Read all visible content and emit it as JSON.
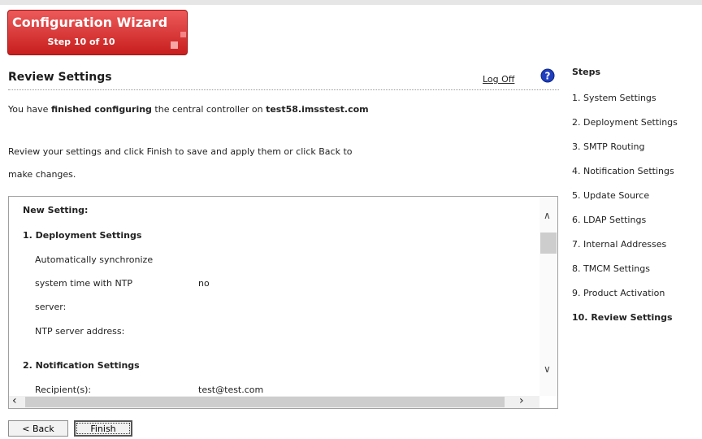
{
  "wizard": {
    "title": "Configuration Wizard",
    "step": "Step 10 of 10"
  },
  "header": {
    "title": "Review Settings",
    "logoff": "Log Off"
  },
  "intro": {
    "prefix": "You have ",
    "bold": "finished configuring",
    "middle": " the central controller on ",
    "host": "test58.imsstest.com"
  },
  "instructions": {
    "line1": "Review your settings and click Finish to save and apply them or click Back to",
    "line2": "make changes."
  },
  "settings": {
    "new_setting": "New Setting:",
    "sections": [
      {
        "title": "1. Deployment Settings",
        "rows": [
          {
            "label": "Automatically synchronize",
            "value": ""
          },
          {
            "label": "system time with NTP",
            "value": "no"
          },
          {
            "label": "server:",
            "value": ""
          },
          {
            "label": "NTP server address:",
            "value": ""
          }
        ]
      },
      {
        "title": "2. Notification Settings",
        "rows": [
          {
            "label": "Recipient(s):",
            "value": "test@test.com"
          }
        ]
      }
    ]
  },
  "buttons": {
    "back": "< Back",
    "finish": "Finish"
  },
  "steps": {
    "title": "Steps",
    "items": [
      "1. System Settings",
      "2. Deployment Settings",
      "3. SMTP Routing",
      "4. Notification Settings",
      "5. Update Source",
      "6. LDAP Settings",
      "7. Internal Addresses",
      "8. TMCM Settings",
      "9. Product Activation",
      "10. Review Settings"
    ],
    "active_index": 9
  },
  "colors": {
    "wizard_red": "#d42a2a",
    "help_blue": "#1f3fbf"
  }
}
